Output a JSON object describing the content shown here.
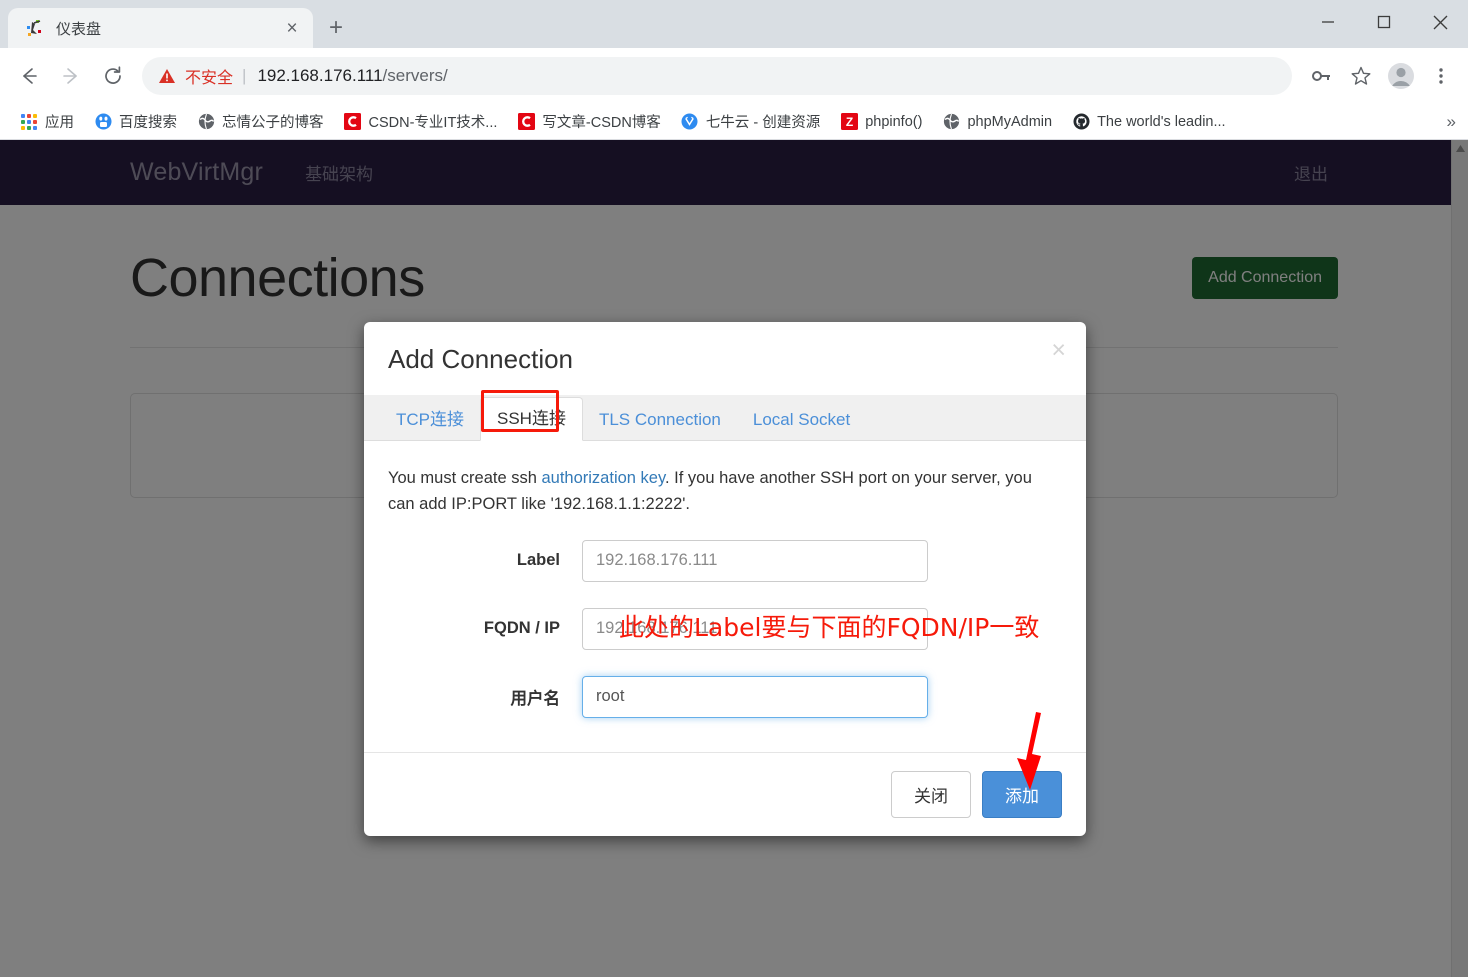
{
  "browser": {
    "tab": {
      "title": "仪表盘",
      "favicon": "dashboard-favicon",
      "close": "×"
    },
    "new_tab": "+",
    "window_controls": {
      "minimize": "—",
      "maximize": "□",
      "close": "✕"
    },
    "nav": {
      "back": "←",
      "forward": "→",
      "reload": "⟳"
    },
    "omnibox": {
      "security_label": "不安全",
      "separator": "|",
      "url_host": "192.168.176.111",
      "url_path": "/servers/"
    },
    "toolbar_icons": [
      "key-icon",
      "star-icon",
      "profile-avatar-icon",
      "chrome-menu-icon"
    ],
    "bookmarks": [
      {
        "label": "应用",
        "icon": "apps-grid-icon"
      },
      {
        "label": "百度搜索",
        "icon": "baidu-icon"
      },
      {
        "label": "忘情公子的博客",
        "icon": "globe-icon"
      },
      {
        "label": "CSDN-专业IT技术...",
        "icon": "csdn-icon"
      },
      {
        "label": "写文章-CSDN博客",
        "icon": "csdn-icon"
      },
      {
        "label": "七牛云 - 创建资源",
        "icon": "qiniu-icon"
      },
      {
        "label": "phpinfo()",
        "icon": "zend-icon"
      },
      {
        "label": "phpMyAdmin",
        "icon": "globe-icon"
      },
      {
        "label": "The world's leadin...",
        "icon": "github-icon"
      }
    ],
    "bookmarks_overflow": "»"
  },
  "navbar": {
    "brand": "WebVirtMgr",
    "links": [
      "基础架构"
    ],
    "logout": "退出"
  },
  "page": {
    "title": "Connections",
    "add_connection_button": "Add Connection"
  },
  "modal": {
    "title": "Add Connection",
    "close_label": "×",
    "tabs": [
      {
        "label": "TCP连接",
        "active": false
      },
      {
        "label": "SSH连接",
        "active": true
      },
      {
        "label": "TLS Connection",
        "active": false
      },
      {
        "label": "Local Socket",
        "active": false
      }
    ],
    "help": {
      "part1": "You must create ssh ",
      "link": "authorization key",
      "part2": ". If you have another SSH port on your server, you can add IP:PORT like '192.168.1.1:2222'."
    },
    "fields": [
      {
        "label": "Label",
        "value": "192.168.176.111",
        "focused": false
      },
      {
        "label": "FQDN / IP",
        "value": "192.168.176.111",
        "focused": false
      },
      {
        "label": "用户名",
        "value": "root",
        "focused": true
      }
    ],
    "buttons": {
      "close": "关闭",
      "submit": "添加"
    }
  },
  "annotations": {
    "label_note": "此处的Label要与下面的FQDN/IP一致",
    "arrow_target": "添加-button"
  },
  "colors": {
    "accent_blue": "#4a90d9",
    "navbar_purple": "#2a1f45",
    "annotation_red": "#f61a0a",
    "insecure_red": "#d93025",
    "add_conn_green": "#1f6b33",
    "link_blue": "#337ab7"
  }
}
